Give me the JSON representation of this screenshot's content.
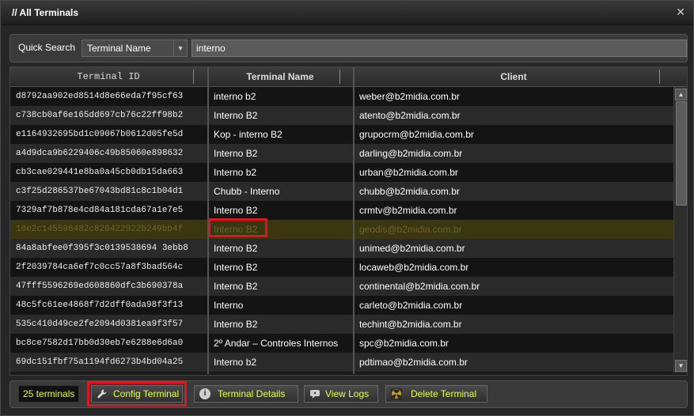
{
  "window": {
    "title": "// All Terminals",
    "close_glyph": "✕"
  },
  "search": {
    "label": "Quick Search",
    "field_selected": "Terminal Name",
    "query": "interno"
  },
  "table": {
    "columns": {
      "id": "Terminal ID",
      "name": "Terminal Name",
      "client": "Client"
    },
    "rows": [
      {
        "id": "d8792aa902ed8514d8e66eda7f95cf63",
        "name": "interno b2",
        "client": "weber@b2midia.com.br"
      },
      {
        "id": "c738cb0af6e165dd697cb76c22ff98b2",
        "name": "Interno B2",
        "client": "atento@b2midia.com.br"
      },
      {
        "id": "e1164932695bd1c09067b0612d05fe5d",
        "name": "Kop - interno B2",
        "client": "grupocrm@b2midia.com.br"
      },
      {
        "id": "a4d9dca9b6229406c49b85060e898632",
        "name": "Interno B2",
        "client": "darling@b2midia.com.br"
      },
      {
        "id": "cb3cae029441e8ba0a45cb0db15da663",
        "name": "Interno b2",
        "client": "urban@b2midia.com.br"
      },
      {
        "id": "c3f25d286537be67043bd81c8c1b04d1",
        "name": "Chubb - Interno",
        "client": "chubb@b2midia.com.br"
      },
      {
        "id": "7329af7b878e4cd84a181cda67a1e7e5",
        "name": "Interno B2",
        "client": "crmtv@b2midia.com.br"
      },
      {
        "id": "10e2c145598482c820422922b249bb4f",
        "name": "Interno B2",
        "client": "geodis@b2midia.com.br",
        "selected": true
      },
      {
        "id": "84a8abfee0f395f3c0139538694 3ebb8",
        "name": "Interno B2",
        "client": "unimed@b2midia.com.br"
      },
      {
        "id": "2f2039784ca6ef7c0cc57a8f3bad564c",
        "name": "Interno B2",
        "client": "locaweb@b2midia.com.br"
      },
      {
        "id": "47fff5596269ed608860dfc3b690378a",
        "name": "Interno B2",
        "client": "continental@b2midia.com.br"
      },
      {
        "id": "48c5fc61ee4868f7d2dff0ada98f3f13",
        "name": "Interno",
        "client": "carleto@b2midia.com.br"
      },
      {
        "id": "535c410d49ce2fe2094d0381ea9f3f57",
        "name": "Interno B2",
        "client": "techint@b2midia.com.br"
      },
      {
        "id": "bc8ce7582d17bb0d30eb7e6288e6d6a0",
        "name": "2º Andar – Controles Internos",
        "client": "spc@b2midia.com.br"
      },
      {
        "id": "69dc151fbf75a1194fd6273b4bd04a25",
        "name": "Interno b2",
        "client": "pdtimao@b2midia.com.br"
      }
    ]
  },
  "footer": {
    "count": "25 terminals",
    "config_label": "Config Terminal",
    "details_label": "Terminal Details",
    "logs_label": "View Logs",
    "delete_label": "Delete Terminal"
  },
  "colors": {
    "accent_text": "#e6ff3c",
    "highlight": "#e0141e",
    "selected_row": "#3a3610"
  },
  "icons": {
    "config": "wrench-icon",
    "details": "info-icon",
    "logs": "chat-icon",
    "delete": "radiation-icon"
  }
}
